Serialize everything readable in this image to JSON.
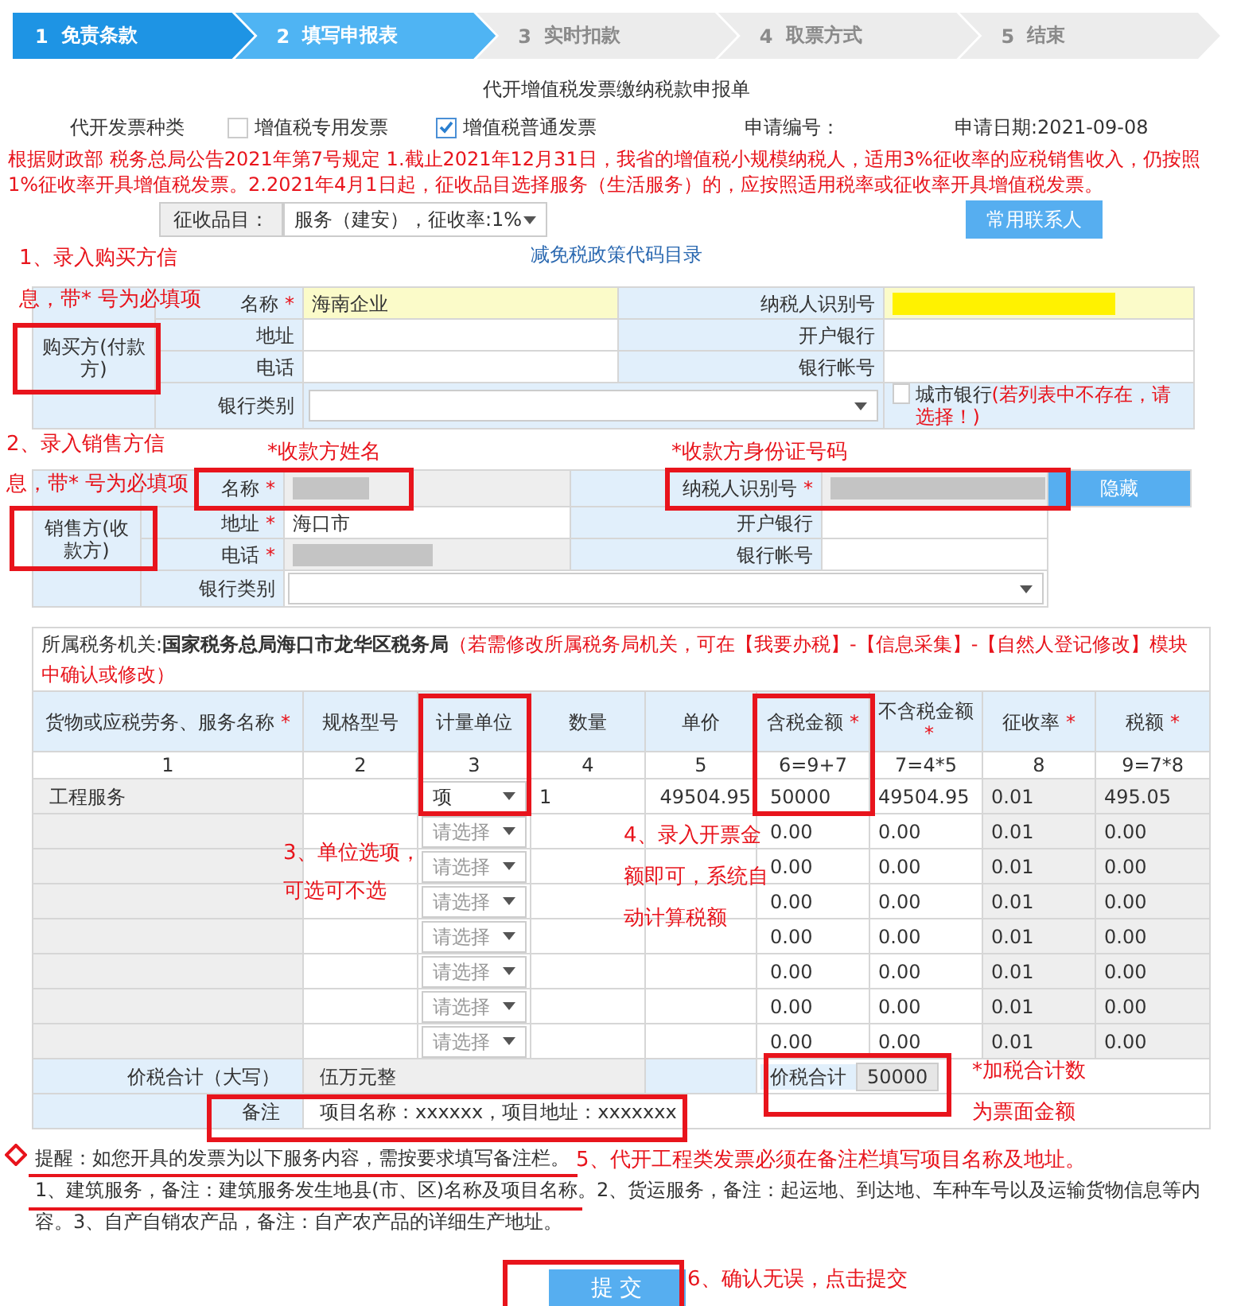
{
  "steps": [
    {
      "number": "1",
      "label": "免责条款",
      "completed": true,
      "selected": false
    },
    {
      "number": "2",
      "label": "填写申报表",
      "completed": false,
      "selected": true
    },
    {
      "number": "3",
      "label": "实时扣款",
      "completed": false,
      "selected": false
    },
    {
      "number": "4",
      "label": "取票方式",
      "completed": false,
      "selected": false
    },
    {
      "number": "5",
      "label": "结束",
      "completed": false,
      "selected": false
    }
  ],
  "form_title": "代开增值税发票缴纳税款申报单",
  "invoice_type": {
    "label": "代开发票种类",
    "options": [
      {
        "label": "增值税专用发票",
        "checked": false
      },
      {
        "label": "增值税普通发票",
        "checked": true
      }
    ]
  },
  "application_no": {
    "label": "申请编号："
  },
  "application_date": "申请日期:2021-09-08",
  "notice": "根据财政部 税务总局公告2021年第7号规定 1.截止2021年12月31日，我省的增值税小规模纳税人，适用3%征收率的应税销售收入，仍按照1%征收率开具增值税发票。2.2021年4月1日起，征收品目选择服务（生活服务）的，应按照适用税率或征收率开具增值税发票。",
  "category": {
    "label": "征收品目：",
    "value": "服务（建安），征收率:1%"
  },
  "contacts_button": "常用联系人",
  "policy_link": "减免税政策代码目录",
  "buyer": {
    "title": "购买方(付款方)",
    "left": [
      {
        "label": "名称",
        "marker": "*",
        "value": "海南企业",
        "highlighted": true
      },
      {
        "label": "地址"
      },
      {
        "label": "电话"
      }
    ],
    "right": [
      {
        "label": "纳税人识别号",
        "highlighted": true,
        "redacted": true
      },
      {
        "label": "开户银行"
      },
      {
        "label": "银行帐号"
      }
    ],
    "bank_type": {
      "label": "银行类别"
    },
    "city_bank": {
      "label": "城市银行",
      "checked": false,
      "hint": "(若列表中不存在，请选择！)"
    }
  },
  "seller": {
    "title": "销售方(收款方)",
    "left": [
      {
        "label": "名称",
        "marker": "*",
        "redacted": true
      },
      {
        "label": "地址",
        "marker": "*",
        "value": "海口市"
      },
      {
        "label": "电话",
        "marker": "*",
        "redacted": true
      }
    ],
    "right": [
      {
        "label": "纳税人识别号",
        "marker": "*",
        "redacted": true
      },
      {
        "label": "开户银行"
      },
      {
        "label": "银行帐号"
      }
    ],
    "hide_button": "隐藏",
    "bank_type": {
      "label": "银行类别"
    }
  },
  "tax_office": {
    "label": "所属税务机关:**国家税务总局海口市龙华区税务局**",
    "note": "（若需修改所属税务局机关，可在【我要办税】-【信息采集】-【自然人登记修改】模块中确认或修改）"
  },
  "columns": [
    {
      "label": "货物或应税劳务、服务名称",
      "marker": "*",
      "index": "1"
    },
    {
      "label": "规格型号",
      "index": "2"
    },
    {
      "label": "计量单位",
      "index": "3"
    },
    {
      "label": "数量",
      "index": "4"
    },
    {
      "label": "单价",
      "index": "5"
    },
    {
      "label": "含税金额",
      "marker": "*",
      "index": "6=9+7"
    },
    {
      "label": "不含税金额",
      "marker": "*",
      "index": "7=4*5"
    },
    {
      "label": "征收率",
      "marker": "*",
      "index": "8"
    },
    {
      "label": "税额",
      "marker": "*",
      "index": "9=7*8"
    }
  ],
  "rows": [
    {
      "name": "工程服务",
      "unit": {
        "value": "项"
      },
      "quantity": "1",
      "price": "49504.95",
      "amount": "50000",
      "amount_excl": "49504.95",
      "rate": "0.01",
      "tax": "495.05"
    },
    {
      "unit": {
        "placeholder": "请选择"
      },
      "amount": "0.00",
      "amount_excl": "0.00",
      "rate": "0.01",
      "tax": "0.00"
    },
    {
      "unit": {
        "placeholder": "请选择"
      },
      "amount": "0.00",
      "amount_excl": "0.00",
      "rate": "0.01",
      "tax": "0.00"
    },
    {
      "unit": {
        "placeholder": "请选择"
      },
      "amount": "0.00",
      "amount_excl": "0.00",
      "rate": "0.01",
      "tax": "0.00"
    },
    {
      "unit": {
        "placeholder": "请选择"
      },
      "amount": "0.00",
      "amount_excl": "0.00",
      "rate": "0.01",
      "tax": "0.00"
    },
    {
      "unit": {
        "placeholder": "请选择"
      },
      "amount": "0.00",
      "amount_excl": "0.00",
      "rate": "0.01",
      "tax": "0.00"
    },
    {
      "unit": {
        "placeholder": "请选择"
      },
      "amount": "0.00",
      "amount_excl": "0.00",
      "rate": "0.01",
      "tax": "0.00"
    },
    {
      "unit": {
        "placeholder": "请选择"
      },
      "amount": "0.00",
      "amount_excl": "0.00",
      "rate": "0.01",
      "tax": "0.00"
    }
  ],
  "total_words": {
    "label": "价税合计（大写）",
    "value": "伍万元整"
  },
  "total": {
    "label": "价税合计",
    "value": "50000"
  },
  "remark": {
    "label": "备注",
    "value": "项目名称：xxxxxx，项目地址：xxxxxxx"
  },
  "reminder": {
    "title": "提醒：如您开具的发票为以下服务内容，需按要求填写备注栏。",
    "text": "1、建筑服务，备注：建筑服务发生地县(市、区)名称及项目名称。2、货运服务，备注：起运地、到达地、车种车号以及运输货物信息等内容。3、自产自销农产品，备注：自产农产品的详细生产地址。"
  },
  "submit_button": "提 交",
  "annotations": [
    {
      "text": "1、录入购买方信"
    },
    {
      "text": "息，带* 号为必填项"
    },
    {
      "text": "2、录入销售方信"
    },
    {
      "text": "息，带* 号为必填项"
    },
    {
      "text": "*收款方姓名"
    },
    {
      "text": "*收款方身份证号码"
    },
    {
      "text": "3、单位选项，"
    },
    {
      "text": "可选可不选"
    },
    {
      "text": "4、录入开票金"
    },
    {
      "text": "额即可，系统自"
    },
    {
      "text": "动计算税额"
    },
    {
      "text": "*加税合计数"
    },
    {
      "text": "为票面金额"
    },
    {
      "text": "5、代开工程类发票必须在备注栏填写项目名称及地址。"
    },
    {
      "text": "6、确认无误，点击提交"
    }
  ]
}
